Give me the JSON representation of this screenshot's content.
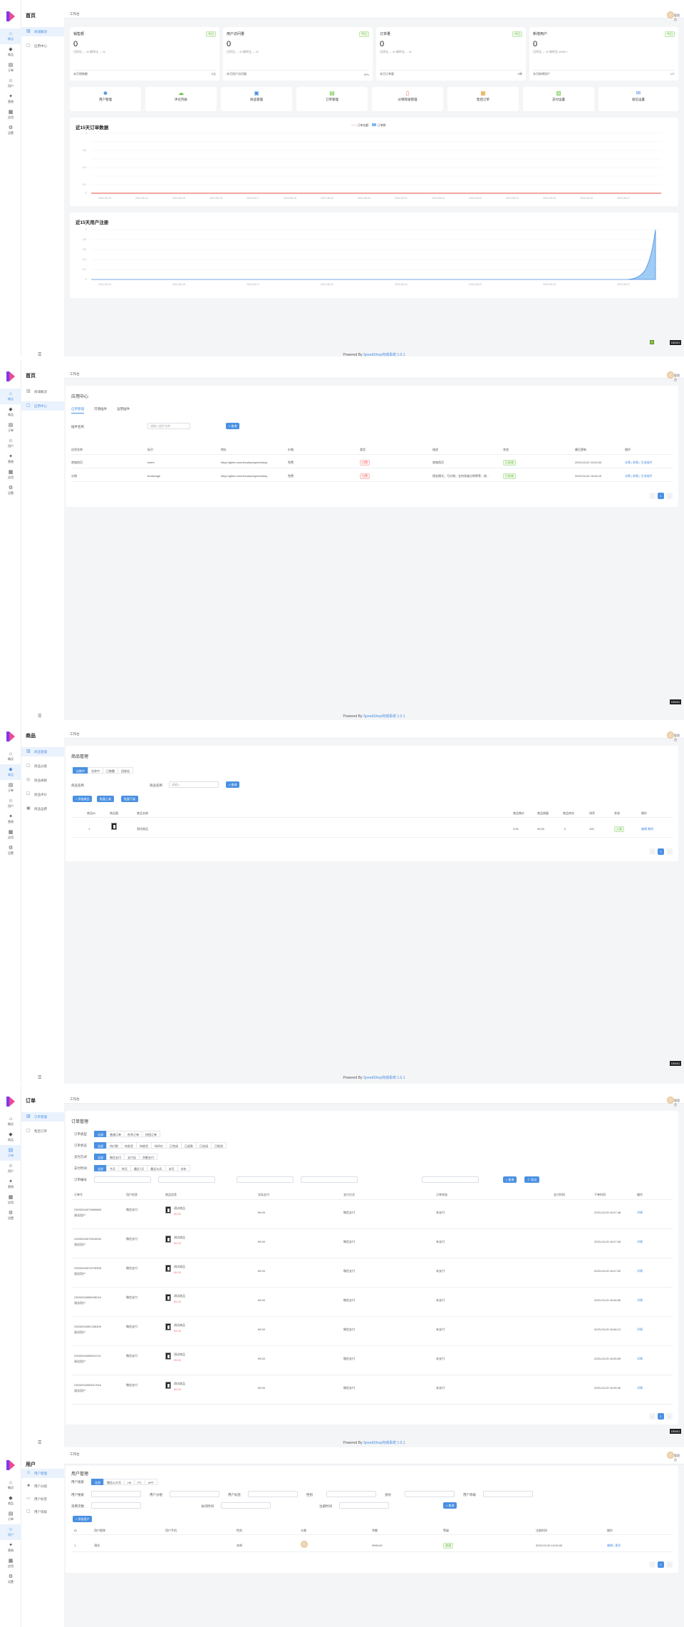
{
  "app": {
    "rail": [
      "概况",
      "商品",
      "订单",
      "用户",
      "营销",
      "应用",
      "设置"
    ],
    "breadcrumb": "工作台",
    "username": "管理员",
    "footer_prefix": "Powered By",
    "footer_link": "SpeedShop商城系统 1.0.1",
    "badge": "DEMO"
  },
  "s1": {
    "title": "首页",
    "subnav": [
      "商城概况",
      "应用中心"
    ],
    "stats": [
      {
        "label": "销售额",
        "tag": "今日",
        "value": "0",
        "sub": "日环比 -- -% 周环比 -- -%",
        "foot": "本月销售额",
        "foot_value": "0元"
      },
      {
        "label": "用户访问量",
        "tag": "今日",
        "value": "0",
        "sub": "日环比 -- -% 周环比 -- -%",
        "foot": "本月用户访问量",
        "foot_value": "0Pv"
      },
      {
        "label": "订单量",
        "tag": "今日",
        "value": "0",
        "sub": "日环比 -- -% 周环比 -- -%",
        "foot": "本月订单量",
        "foot_value": "0单"
      },
      {
        "label": "新增用户",
        "tag": "今日",
        "value": "0",
        "sub": "日环比 -- -% 周环比 100% ↑",
        "foot": "本月新增用户",
        "foot_value": "1人"
      }
    ],
    "quick": [
      "用户管理",
      "评论列表",
      "商品管理",
      "订单管理",
      "分销等级管理",
      "售后订单",
      "支付设置",
      "短信设置"
    ],
    "order_chart": {
      "title": "近15天订单数据",
      "legend": [
        "订单金额",
        "订单数"
      ]
    },
    "user_chart": {
      "title": "近15天用户注册"
    }
  },
  "s2": {
    "title": "首页",
    "subnav": [
      "商城概况",
      "应用中心"
    ],
    "panel_title": "应用中心",
    "tabs": [
      "应用管理",
      "可增插件",
      "运营插件"
    ],
    "form_label": "插件名称",
    "input_placeholder": "请输入插件名称",
    "search_btn": "查询",
    "headers": [
      "应用名称",
      "标识",
      "地址",
      "价格",
      "类型",
      "描述",
      "状态",
      "最后更新",
      "操作"
    ],
    "rows": [
      {
        "name": "商城首页",
        "key": "index",
        "url": "https://gitee.com/zhoutao/speedshop",
        "price": "免费",
        "type": "付费",
        "desc": "商城首页",
        "status": "已安装",
        "date": "2023-03-22 10:00:00",
        "ops": "详情 | 卸载 | 生成插件"
      },
      {
        "name": "分销",
        "key": "brokerage",
        "url": "https://gitee.com/zhoutao/speedshop",
        "price": "免费",
        "type": "付费",
        "desc": "佣金模式，可分销，支持多级分销等等，按...",
        "status": "已安装",
        "date": "2023-04-02 15:45:19",
        "ops": "详情 | 卸载 | 生成插件"
      }
    ]
  },
  "s3": {
    "title": "商品",
    "subnav": [
      "商品管理",
      "商品分类",
      "商品规格",
      "商品评价",
      "商品运费"
    ],
    "panel_title": "商品管理",
    "segs": [
      "出售中",
      "仓库中",
      "已售罄",
      "回收站"
    ],
    "form_label": "商品名称",
    "input_placeholder": "请输入",
    "search_btn": "查询",
    "actions": [
      "+ 添加商品",
      "批量上架",
      "批量下架"
    ],
    "headers": [
      "商品ID",
      "商品图",
      "商品名称",
      "商品售价",
      "商品销量",
      "商品库存",
      "排序",
      "状态",
      "操作"
    ],
    "row": {
      "id": "1",
      "name": "测试商品",
      "price": "9.00",
      "sales": "99.00",
      "stock": "0",
      "sort": "100",
      "status": "上架",
      "ops": "编辑 删除"
    }
  },
  "s4": {
    "title": "订单",
    "subnav": [
      "订单管理",
      "售后订单"
    ],
    "panel_title": "订单管理",
    "filter_labels": [
      "订单类型",
      "订单状态",
      "支付方式",
      "支付时间",
      "订单编号"
    ],
    "type_segs": [
      "全部",
      "普通订单",
      "秒杀订单",
      "拼团订单"
    ],
    "status_segs": [
      "全部",
      "待付款",
      "待发货",
      "待收货",
      "待评价",
      "已完成",
      "已退款",
      "已关闭",
      "已取消"
    ],
    "pay_segs": [
      "全部",
      "微信支付",
      "支付宝",
      "余额支付"
    ],
    "time_segs": [
      "全部",
      "今天",
      "昨天",
      "最近7天",
      "最近30天",
      "本月",
      "本年"
    ],
    "search_btn": "查询",
    "export_btn": "导出",
    "headers": [
      "订单号",
      "用户信息",
      "商品信息",
      "实际支付",
      "支付方式",
      "订单状态",
      "支付时间",
      "下单时间",
      "操作"
    ],
    "rows": [
      {
        "no": "23032916074860668",
        "user": "测试用户",
        "goods": "测试商品",
        "pay": "¥9.00",
        "method": "微信支付",
        "status": "未支付",
        "time": "2023-03-29 16:07:48",
        "op": "详情"
      },
      {
        "no": "23032916072610005",
        "user": "测试用户",
        "goods": "测试商品",
        "pay": "¥9.00",
        "method": "微信支付",
        "status": "未支付",
        "time": "2023-03-29 16:07:26",
        "op": "详情"
      },
      {
        "no": "23032916070278398",
        "user": "测试用户",
        "goods": "测试商品",
        "pay": "¥9.00",
        "method": "微信支付",
        "status": "未支付",
        "time": "2023-03-29 16:07:02",
        "op": "详情"
      },
      {
        "no": "23032916065035216",
        "user": "测试用户",
        "goods": "测试商品",
        "pay": "¥9.00",
        "method": "微信支付",
        "status": "未支付",
        "time": "2023-03-29 16:06:50",
        "op": "详情"
      },
      {
        "no": "23032916061256309",
        "user": "测试用户",
        "goods": "测试商品",
        "pay": "¥9.00",
        "method": "微信支付",
        "status": "未支付",
        "time": "2023-03-29 16:06:12",
        "op": "详情"
      },
      {
        "no": "23032916055911213",
        "user": "测试用户",
        "goods": "测试商品",
        "pay": "¥9.00",
        "method": "微信支付",
        "status": "未支付",
        "time": "2023-03-29 16:05:59",
        "op": "详情"
      },
      {
        "no": "23032916053017516",
        "user": "测试用户",
        "goods": "测试商品",
        "pay": "¥9.00",
        "method": "微信支付",
        "status": "未支付",
        "time": "2023-03-29 16:05:30",
        "op": "详情"
      }
    ]
  },
  "s5": {
    "title": "用户",
    "subnav": [
      "用户管理",
      "用户分组",
      "用户标签",
      "用户等级"
    ],
    "panel_title": "用户管理",
    "segs": [
      "全部",
      "微信公众号",
      "H5",
      "PC",
      "APP"
    ],
    "filter_labels": [
      "用户搜索",
      "用户分组",
      "用户标签",
      "性别",
      "身份",
      "用户等级",
      "消费次数",
      "访问时间",
      "注册时间"
    ],
    "search_btn": "查询",
    "add_btn": "+ 添加用户",
    "headers": [
      "ID",
      "用户昵称",
      "用户手机",
      "性别",
      "头像",
      "余额",
      "等级",
      "注册时间",
      "操作"
    ],
    "row": {
      "id": "1",
      "nick": "测试",
      "gender": "未知",
      "balance": "9999.00",
      "level": "普通",
      "date": "2023-03-29 13:00:00",
      "ops": "编辑 | 更多"
    }
  }
}
